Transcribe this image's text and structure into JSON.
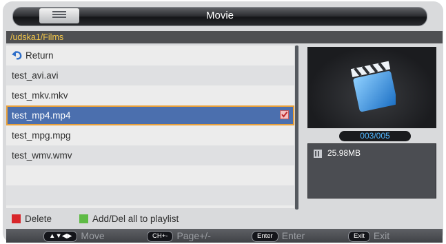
{
  "header": {
    "title": "Movie",
    "menu_icon": "list-icon"
  },
  "path": "/udska1/Films",
  "files": [
    {
      "label": "Return",
      "icon": "return-icon"
    },
    {
      "label": "test_avi.avi"
    },
    {
      "label": "test_mkv.mkv"
    },
    {
      "label": "test_mp4.mp4",
      "selected": true,
      "checked": true
    },
    {
      "label": "test_mpg.mpg"
    },
    {
      "label": "test_wmv.wmv"
    }
  ],
  "preview": {
    "icon": "clapperboard-icon",
    "counter": "003/005"
  },
  "info": {
    "size": "25.98MB",
    "icon": "file-info-icon"
  },
  "legend": [
    {
      "label": "Delete",
      "color": "#d8262a"
    },
    {
      "label": "Add/Del all to playlist",
      "color": "#5fbb46"
    }
  ],
  "hints": [
    {
      "key": "▲▼◀▶",
      "label": "Move"
    },
    {
      "key": "CH+-",
      "label": "Page+/-"
    },
    {
      "key": "Enter",
      "label": "Enter"
    },
    {
      "key": "Exit",
      "label": "Exit"
    }
  ],
  "colors": {
    "selection": "#4b6fae",
    "path_text": "#f5c84a",
    "counter_text": "#4fb6ff"
  }
}
